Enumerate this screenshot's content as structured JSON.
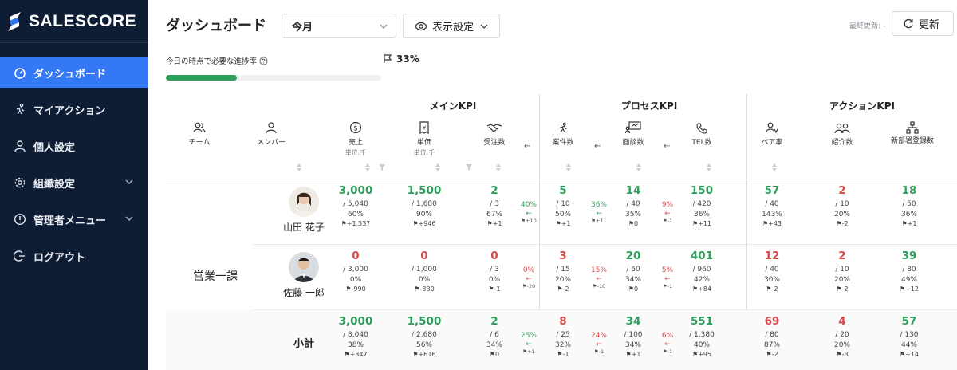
{
  "app": {
    "logo_text": "SALESCORE"
  },
  "sidebar": {
    "items": [
      {
        "label": "ダッシュボード",
        "icon": "dashboard-icon",
        "active": true
      },
      {
        "label": "マイアクション",
        "icon": "running-icon"
      },
      {
        "label": "個人設定",
        "icon": "user-icon"
      },
      {
        "label": "組織設定",
        "icon": "gear-icon",
        "expandable": true
      },
      {
        "label": "管理者メニュー",
        "icon": "info-icon",
        "expandable": true
      },
      {
        "label": "ログアウト",
        "icon": "logout-icon"
      }
    ]
  },
  "header": {
    "title": "ダッシュボード",
    "period": "今月",
    "display_settings": "表示設定",
    "last_updated": "最終更新: -",
    "refresh": "更新"
  },
  "progress": {
    "label": "今日の時点で必要な進捗率",
    "value_text": "33%",
    "value": 0.33,
    "color": "#2e9e5a"
  },
  "table": {
    "groups": {
      "main": "メインKPI",
      "process": "プロセスKPI",
      "action": "アクションKPI"
    },
    "columns": {
      "team": "チーム",
      "member": "メンバー",
      "sales": "売上",
      "sales_unit": "単位:千",
      "unit_price": "単価",
      "unit_price_unit": "単位:千",
      "orders": "受注数",
      "deals": "案件数",
      "meetings": "面談数",
      "tel": "TEL数",
      "pair": "ペア率",
      "referrals": "紹介数",
      "new_dept": "新部署登録数"
    },
    "arrow": "←",
    "team_name": "営業一課",
    "subtotal_label": "小計",
    "rows": [
      {
        "member": "山田 花子",
        "sales": {
          "v": "3,000",
          "t": "/ 5,040",
          "p": "60%",
          "f": "+1,337",
          "s": "g"
        },
        "unit_price": {
          "v": "1,500",
          "t": "/ 1,680",
          "p": "90%",
          "f": "+946",
          "s": "g"
        },
        "orders": {
          "v": "2",
          "t": "/ 3",
          "p": "67%",
          "f": "+1",
          "s": "g"
        },
        "conv1": {
          "c": "40%",
          "s": "+10",
          "st": "g"
        },
        "deals": {
          "v": "5",
          "t": "/ 10",
          "p": "50%",
          "f": "+1",
          "s": "g"
        },
        "conv2": {
          "c": "36%",
          "s": "+11",
          "st": "g"
        },
        "meetings": {
          "v": "14",
          "t": "/ 40",
          "p": "35%",
          "f": "0",
          "s": "g"
        },
        "conv3": {
          "c": "9%",
          "s": "-1",
          "st": "r"
        },
        "tel": {
          "v": "150",
          "t": "/ 420",
          "p": "36%",
          "f": "+11",
          "s": "g"
        },
        "pair": {
          "v": "57",
          "t": "/ 40",
          "p": "143%",
          "f": "+43",
          "s": "g"
        },
        "referrals": {
          "v": "2",
          "t": "/ 10",
          "p": "20%",
          "f": "-2",
          "s": "r"
        },
        "new_dept": {
          "v": "18",
          "t": "/ 50",
          "p": "36%",
          "f": "+1",
          "s": "g"
        }
      },
      {
        "member": "佐藤 一郎",
        "sales": {
          "v": "0",
          "t": "/ 3,000",
          "p": "0%",
          "f": "-990",
          "s": "r"
        },
        "unit_price": {
          "v": "0",
          "t": "/ 1,000",
          "p": "0%",
          "f": "-330",
          "s": "r"
        },
        "orders": {
          "v": "0",
          "t": "/ 3",
          "p": "0%",
          "f": "-1",
          "s": "r"
        },
        "conv1": {
          "c": "0%",
          "s": "-20",
          "st": "r"
        },
        "deals": {
          "v": "3",
          "t": "/ 15",
          "p": "20%",
          "f": "-2",
          "s": "r"
        },
        "conv2": {
          "c": "15%",
          "s": "-10",
          "st": "r"
        },
        "meetings": {
          "v": "20",
          "t": "/ 60",
          "p": "34%",
          "f": "0",
          "s": "g"
        },
        "conv3": {
          "c": "5%",
          "s": "-1",
          "st": "r"
        },
        "tel": {
          "v": "401",
          "t": "/ 960",
          "p": "42%",
          "f": "+84",
          "s": "g"
        },
        "pair": {
          "v": "12",
          "t": "/ 40",
          "p": "30%",
          "f": "-2",
          "s": "r"
        },
        "referrals": {
          "v": "2",
          "t": "/ 10",
          "p": "20%",
          "f": "-2",
          "s": "r"
        },
        "new_dept": {
          "v": "39",
          "t": "/ 80",
          "p": "49%",
          "f": "+12",
          "s": "g"
        }
      },
      {
        "member": "小計",
        "sales": {
          "v": "3,000",
          "t": "/ 8,040",
          "p": "38%",
          "f": "+347",
          "s": "g"
        },
        "unit_price": {
          "v": "1,500",
          "t": "/ 2,680",
          "p": "56%",
          "f": "+616",
          "s": "g"
        },
        "orders": {
          "v": "2",
          "t": "/ 6",
          "p": "34%",
          "f": "0",
          "s": "g"
        },
        "conv1": {
          "c": "25%",
          "s": "+1",
          "st": "g"
        },
        "deals": {
          "v": "8",
          "t": "/ 25",
          "p": "32%",
          "f": "-1",
          "s": "r"
        },
        "conv2": {
          "c": "24%",
          "s": "-1",
          "st": "r"
        },
        "meetings": {
          "v": "34",
          "t": "/ 100",
          "p": "34%",
          "f": "+1",
          "s": "g"
        },
        "conv3": {
          "c": "6%",
          "s": "-1",
          "st": "r"
        },
        "tel": {
          "v": "551",
          "t": "/ 1,380",
          "p": "40%",
          "f": "+95",
          "s": "g"
        },
        "pair": {
          "v": "69",
          "t": "/ 80",
          "p": "87%",
          "f": "-2",
          "s": "r"
        },
        "referrals": {
          "v": "4",
          "t": "/ 20",
          "p": "20%",
          "f": "-3",
          "s": "r"
        },
        "new_dept": {
          "v": "57",
          "t": "/ 130",
          "p": "44%",
          "f": "+14",
          "s": "g"
        }
      }
    ]
  },
  "colors": {
    "sidebar": "#0f1d34",
    "active": "#3478f6",
    "positive": "#2e9e5a",
    "negative": "#d74a4a"
  }
}
